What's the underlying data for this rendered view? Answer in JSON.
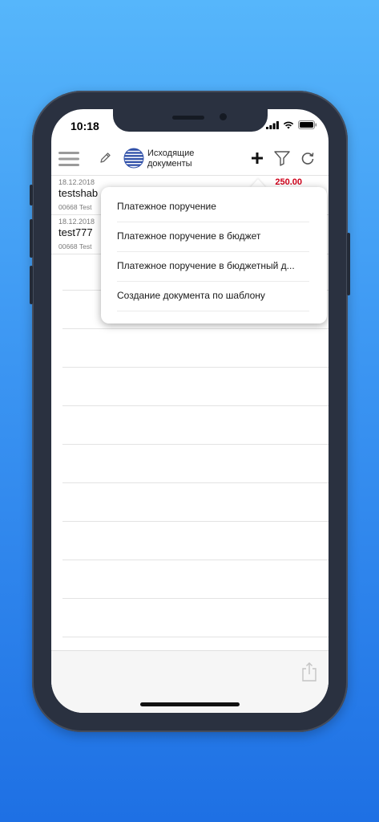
{
  "status_bar": {
    "time": "10:18"
  },
  "toolbar": {
    "title_line1": "Исходящие",
    "title_line2": "документы"
  },
  "documents": [
    {
      "date": "18.12.2018",
      "name": "testshab",
      "sub": "00668 Test",
      "amount": "250.00"
    },
    {
      "date": "18.12.2018",
      "name": "test777",
      "sub": "00668 Test",
      "amount": ""
    }
  ],
  "add_menu": {
    "items": [
      {
        "label": "Платежное поручение"
      },
      {
        "label": "Платежное поручение в бюджет"
      },
      {
        "label": "Платежное поручение в бюджетный д..."
      },
      {
        "label": "Создание документа по шаблону"
      }
    ]
  },
  "colors": {
    "background_top": "#56b6fb",
    "background_bottom": "#1e70e4",
    "amount_red": "#d0021b",
    "logo_blue": "#2f4fa8"
  },
  "icons": {
    "menu": "hamburger-icon",
    "edit": "pencil-icon",
    "logo": "bank-logo-icon",
    "add": "plus-icon",
    "filter": "filter-icon",
    "refresh": "refresh-icon",
    "share": "share-icon"
  }
}
